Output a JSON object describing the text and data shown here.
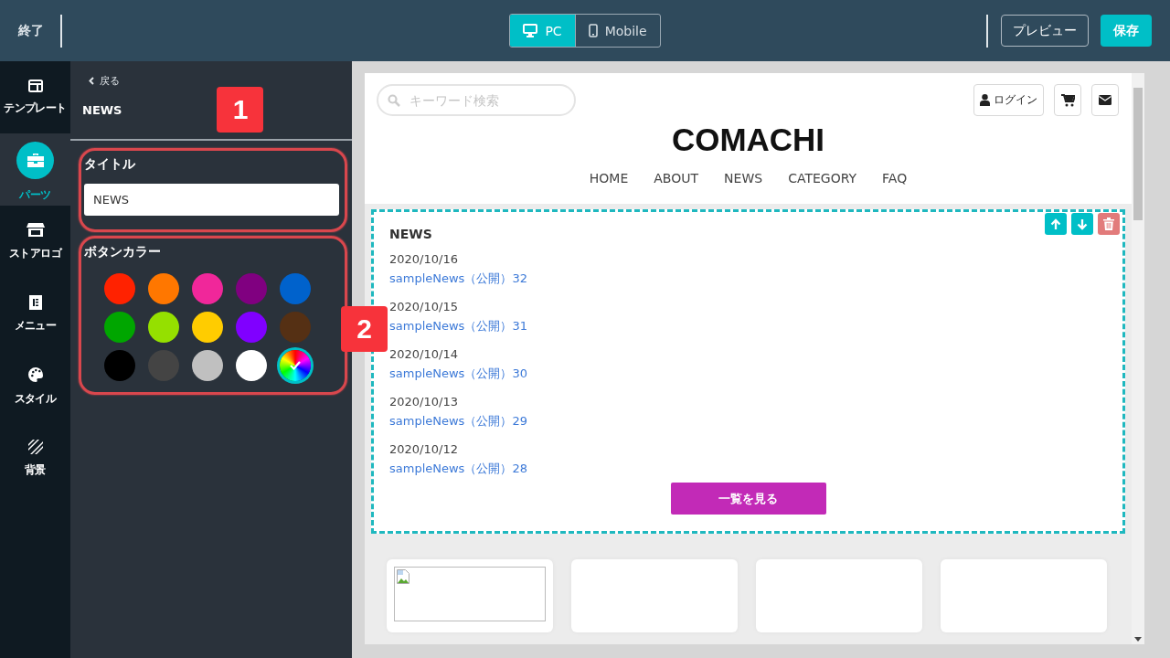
{
  "top_bar": {
    "exit": "終了",
    "view_modes": [
      {
        "label": "PC",
        "selected": true
      },
      {
        "label": "Mobile",
        "selected": false
      }
    ],
    "preview": "プレビュー",
    "save": "保存"
  },
  "rail": [
    {
      "label": "テンプレート",
      "selected": false
    },
    {
      "label": "パーツ",
      "selected": true
    },
    {
      "label": "ストアロゴ",
      "selected": false
    },
    {
      "label": "メニュー",
      "selected": false
    },
    {
      "label": "スタイル",
      "selected": false
    },
    {
      "label": "背景",
      "selected": false
    }
  ],
  "panel": {
    "back": "戻る",
    "heading": "NEWS",
    "badge": "1",
    "title_label": "タイトル",
    "title_value": "NEWS",
    "color_label": "ボタンカラー",
    "badge_2": "2",
    "swatches": [
      {
        "kind": "solid",
        "color": "#ff2200",
        "selected": false
      },
      {
        "kind": "solid",
        "color": "#ff7700",
        "selected": false
      },
      {
        "kind": "solid",
        "color": "#f0279a",
        "selected": false
      },
      {
        "kind": "solid",
        "color": "#800080",
        "selected": false
      },
      {
        "kind": "solid",
        "color": "#0062cc",
        "selected": false
      },
      {
        "kind": "solid",
        "color": "#00a600",
        "selected": false
      },
      {
        "kind": "solid",
        "color": "#95e000",
        "selected": false
      },
      {
        "kind": "solid",
        "color": "#ffcc00",
        "selected": false
      },
      {
        "kind": "solid",
        "color": "#8000ff",
        "selected": false
      },
      {
        "kind": "solid",
        "color": "#553014",
        "selected": false
      },
      {
        "kind": "solid",
        "color": "#000000",
        "selected": false
      },
      {
        "kind": "solid",
        "color": "#444444",
        "selected": false
      },
      {
        "kind": "solid",
        "color": "#c0c0c0",
        "selected": false
      },
      {
        "kind": "solid",
        "color": "#ffffff",
        "selected": false
      },
      {
        "kind": "custom",
        "selected": true
      }
    ]
  },
  "site": {
    "search_placeholder": "キーワード検索",
    "login": "ログイン",
    "logo": "COMACHI",
    "nav": [
      "HOME",
      "ABOUT",
      "NEWS",
      "CATEGORY",
      "FAQ"
    ],
    "news": {
      "heading": "NEWS",
      "items": [
        {
          "date": "2020/10/16",
          "title": "sampleNews（公開）32"
        },
        {
          "date": "2020/10/15",
          "title": "sampleNews（公開）31"
        },
        {
          "date": "2020/10/14",
          "title": "sampleNews（公開）30"
        },
        {
          "date": "2020/10/13",
          "title": "sampleNews（公開）29"
        },
        {
          "date": "2020/10/12",
          "title": "sampleNews（公開）28"
        }
      ],
      "more_button": "一覧を見る"
    }
  }
}
